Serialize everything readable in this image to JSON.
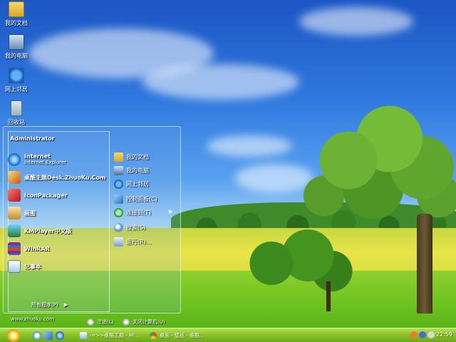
{
  "desktop": {
    "icons": [
      {
        "label": "我的文档",
        "icon": "folder-icon"
      },
      {
        "label": "我的电脑",
        "icon": "computer-icon"
      },
      {
        "label": "网上邻居",
        "icon": "network-icon"
      },
      {
        "label": "回收站",
        "icon": "recycle-bin-icon"
      }
    ]
  },
  "start_menu": {
    "user": "Administrator",
    "programs": [
      {
        "name": "Internet",
        "sub": "Internet Explorer",
        "icon": "internet-explorer-icon"
      },
      {
        "name": "桌酷主题Desk.ZhuoKu.Com",
        "icon": "zhuoku-icon"
      },
      {
        "name": "IconPackager",
        "icon": "iconpackager-icon"
      },
      {
        "name": "画图",
        "icon": "paint-icon"
      },
      {
        "name": "KMPlayer中文版",
        "icon": "kmplayer-icon"
      },
      {
        "name": "WinRAR",
        "icon": "winrar-icon"
      },
      {
        "name": "记事本",
        "icon": "notepad-icon"
      }
    ],
    "all_programs": "所有程序(P)",
    "all_programs_arrow": "▶",
    "url": "www.zhuoku.com",
    "places": [
      {
        "label": "我的文档",
        "icon": "folder-icon"
      },
      {
        "label": "我的电脑",
        "icon": "computer-icon"
      },
      {
        "label": "网上邻居",
        "icon": "network-icon"
      },
      {
        "label": "控制面板(C)",
        "icon": "control-panel-icon"
      },
      {
        "label": "连接到(T)",
        "icon": "connect-icon"
      },
      {
        "label": "搜索(S)",
        "icon": "search-icon"
      },
      {
        "label": "运行(R)...",
        "icon": "run-icon"
      }
    ],
    "submenu_arrow": "▶",
    "logoff": "注销(L)",
    "shutdown": "关闭计算机(U)"
  },
  "taskbar": {
    "tasks": [
      {
        "label": "-=>>桌酷主题 - Mi...",
        "icon": "document-icon"
      },
      {
        "label": "桌面 - 壁纸 - 桌酷...",
        "icon": "chrome-icon"
      }
    ],
    "clock": "22:59"
  }
}
